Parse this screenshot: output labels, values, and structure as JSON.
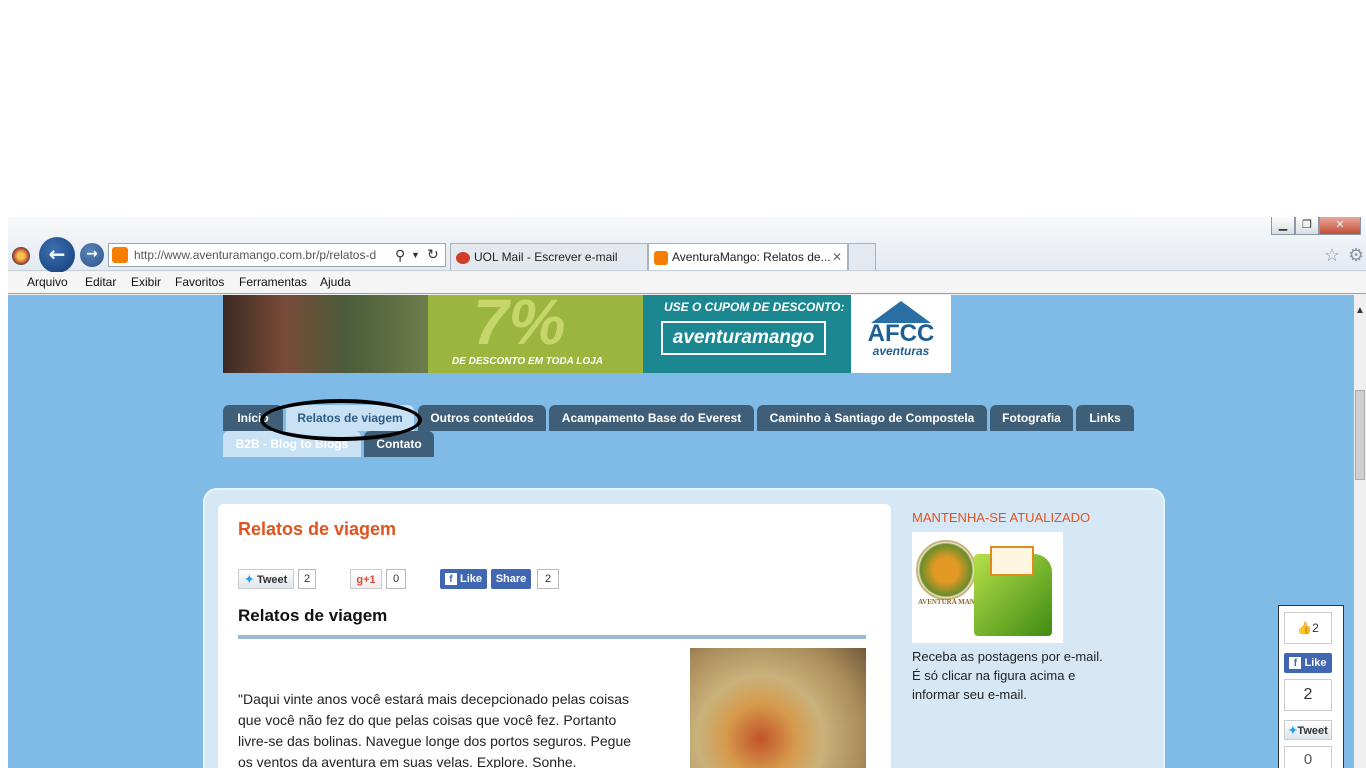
{
  "browser": {
    "address_url": "http://www.aventuramango.com.br/p/relatos-d",
    "tabs": [
      {
        "label": "UOL Mail - Escrever e-mail"
      },
      {
        "label": "AventuraMango: Relatos de..."
      }
    ],
    "menu": [
      "Arquivo",
      "Editar",
      "Exibir",
      "Favoritos",
      "Ferramentas",
      "Ajuda"
    ]
  },
  "banner": {
    "percent": "7%",
    "discount_text": "DE DESCONTO EM TODA LOJA",
    "coupon_heading": "USE O CUPOM DE DESCONTO:",
    "coupon_code": "aventuramango",
    "brand": "AFCC",
    "brand_sub": "aventuras"
  },
  "nav": {
    "tabs": [
      "Início",
      "Relatos de viagem",
      "Outros conteúdos",
      "Acampamento Base do Everest",
      "Caminho à Santiago de Compostela",
      "Fotografia",
      "Links"
    ],
    "tabs_row2": [
      "B2B - Blog to Blogs",
      "Contato"
    ]
  },
  "post": {
    "page_title": "Relatos de viagem",
    "heading": "Relatos de viagem",
    "tweet_label": "Tweet",
    "tweet_count": "2",
    "gplus_label": "+1",
    "gplus_count": "0",
    "fb_like_label": "Like",
    "fb_share_label": "Share",
    "fb_share_count": "2",
    "paragraph_lines": [
      "\"Daqui vinte anos você estará mais decepcionado pelas coisas",
      "que você não fez do que pelas coisas que você fez. Portanto",
      "livre-se das bolinas. Navegue longe dos portos seguros. Pegue",
      "os ventos da aventura em suas velas. Explore. Sonhe."
    ]
  },
  "sidebar": {
    "heading": "MANTENHA-SE ATUALIZADO",
    "text_lines": [
      "Receba as postagens por e-mail.",
      "É só clicar na figura acima e",
      "informar seu e-mail."
    ],
    "logo_text": "AVENTURA MANGO"
  },
  "floating_share": {
    "like_count": "2",
    "fb_like_label": "Like",
    "fb_count": "2",
    "tweet_label": "Tweet",
    "tweet_count": "0"
  },
  "colors": {
    "page_bg": "#80bbe7",
    "nav_tab": "#3f5f79",
    "accent_orange": "#e0531f",
    "facebook": "#4267b2"
  }
}
